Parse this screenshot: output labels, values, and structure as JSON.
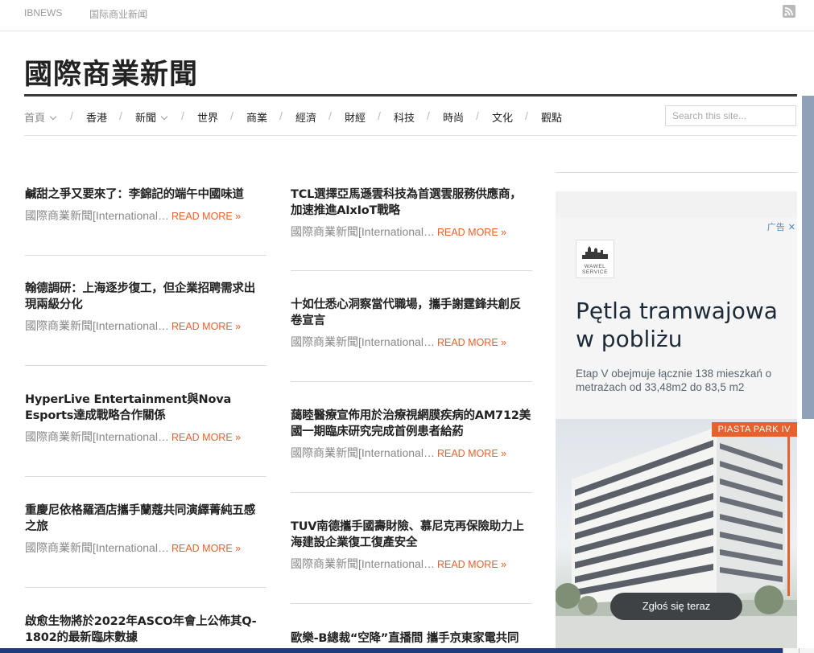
{
  "topbar": {
    "link1": "IBNEWS",
    "link2": "国际商业新闻",
    "rss_icon": "rss-icon"
  },
  "site": {
    "title": "國際商業新聞"
  },
  "nav": {
    "items": [
      {
        "label": "首頁",
        "dropdown": true,
        "active": true
      },
      {
        "label": "香港"
      },
      {
        "label": "新聞",
        "dropdown": true
      },
      {
        "label": "世界"
      },
      {
        "label": "商業"
      },
      {
        "label": "經濟"
      },
      {
        "label": "財經"
      },
      {
        "label": "科技"
      },
      {
        "label": "時尚"
      },
      {
        "label": "文化"
      },
      {
        "label": "觀點"
      }
    ],
    "separator": "/",
    "search_placeholder": "Search this site..."
  },
  "posts": {
    "left": [
      {
        "title": "鹹甜之爭又要來了：李錦記的端午中國味道",
        "excerpt": "國際商業新聞[International…",
        "more": "READ MORE »"
      },
      {
        "title": "翰德調研：上海逐步復工，但企業招聘需求出現兩級分化",
        "excerpt": "國際商業新聞[International…",
        "more": "READ MORE »"
      },
      {
        "title": "HyperLive Entertainment與Nova Esports達成戰略合作關係",
        "excerpt": "國際商業新聞[International…",
        "more": "READ MORE »"
      },
      {
        "title": "重慶尼依格羅酒店攜手蘭蔻共同演繹菁純五感之旅",
        "excerpt": "國際商業新聞[International…",
        "more": "READ MORE »"
      },
      {
        "title": "啟愈生物將於2022年ASCO年會上公佈其Q-1802的最新臨床數據",
        "excerpt": "",
        "more": ""
      }
    ],
    "right": [
      {
        "title": "TCL選擇亞馬遜雲科技為首選雲服務供應商，加速推進AIxIoT戰略",
        "excerpt": "國際商業新聞[International…",
        "more": "READ MORE »"
      },
      {
        "title": "十如仕悉心洞察當代職場，攜手謝霆鋒共創反卷宣言",
        "excerpt": "國際商業新聞[International…",
        "more": "READ MORE »"
      },
      {
        "title": "藹睦醫療宣佈用於治療視網膜疾病的AM712美國一期臨床研究完成首例患者給葯",
        "excerpt": "國際商業新聞[International…",
        "more": "READ MORE »"
      },
      {
        "title": "TUV南德攜手國壽財險、慕尼克再保險助力上海建設企業復工復產安全",
        "excerpt": "國際商業新聞[International…",
        "more": "READ MORE »"
      },
      {
        "title": "歐樂-B總裁“空降”直播間 攜手京東家電共同",
        "excerpt": "",
        "more": ""
      }
    ]
  },
  "ad": {
    "label": "广告",
    "close": "✕",
    "logo_text_1": "WAWEL",
    "logo_text_2": "SERVICE",
    "headline": "Pętla tramwajowa w pobliżu",
    "body": "Etap V obejmuje łącznie 138 mieszkań o metrażach od 33,48m2 do 83,5 m2",
    "tag": "PIASTA PARK IV",
    "cta": "Zgłoś się teraz"
  },
  "colors": {
    "accent": "#e8612c",
    "text": "#222222",
    "muted": "#888888"
  }
}
